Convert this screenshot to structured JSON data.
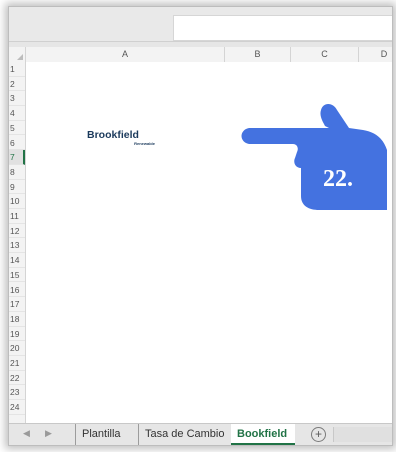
{
  "columns": [
    "A",
    "B",
    "C",
    "D"
  ],
  "rows": [
    "1",
    "2",
    "3",
    "4",
    "5",
    "6",
    "7",
    "8",
    "9",
    "10",
    "11",
    "12",
    "13",
    "14",
    "15",
    "16",
    "17",
    "18",
    "19",
    "20",
    "21",
    "22",
    "23",
    "24"
  ],
  "active_row": "7",
  "logo": {
    "main": "Brookfield",
    "sub": "Renewable"
  },
  "callout": {
    "number": "22.",
    "color": "#4472e0"
  },
  "tabs": [
    "Plantilla",
    "Tasa de Cambio",
    "Bookfield"
  ],
  "active_tab": "Bookfield",
  "nav": {
    "prev": "◀",
    "next": "▶"
  },
  "add_sheet_label": "+",
  "colors": {
    "accent": "#217346",
    "logo": "#1b3a5c",
    "hand": "#4472e0"
  }
}
